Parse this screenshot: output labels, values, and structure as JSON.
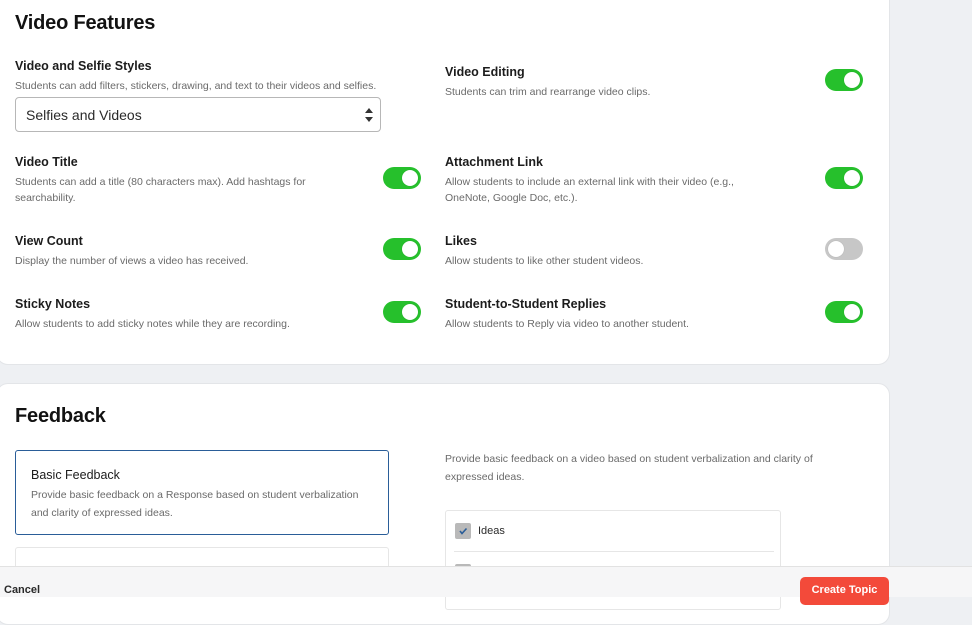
{
  "video_features": {
    "title": "Video Features",
    "styles": {
      "title": "Video and Selfie Styles",
      "description": "Students can add filters, stickers, drawing, and text to their videos and selfies.",
      "selected": "Selfies and Videos"
    },
    "items": [
      {
        "title": "Video Editing",
        "description": "Students can trim and rearrange video clips.",
        "enabled": true
      },
      {
        "title": "Video Title",
        "description": "Students can add a title (80 characters max). Add hashtags for searchability.",
        "enabled": true
      },
      {
        "title": "Attachment Link",
        "description": "Allow students to include an external link with their video (e.g., OneNote, Google Doc, etc.).",
        "enabled": true
      },
      {
        "title": "View Count",
        "description": "Display the number of views a video has received.",
        "enabled": true
      },
      {
        "title": "Likes",
        "description": "Allow students to like other student videos.",
        "enabled": false
      },
      {
        "title": "Sticky Notes",
        "description": "Allow students to add sticky notes while they are recording.",
        "enabled": true
      },
      {
        "title": "Student-to-Student Replies",
        "description": "Allow students to Reply via video to another student.",
        "enabled": true
      }
    ]
  },
  "feedback": {
    "title": "Feedback",
    "option": {
      "title": "Basic Feedback",
      "description": "Provide basic feedback on a Response based on student verbalization and clarity of expressed ideas."
    },
    "detail_description": "Provide basic feedback on a video based on student verbalization and clarity of expressed ideas.",
    "criteria": [
      {
        "label": "Ideas",
        "checked": true
      }
    ]
  },
  "footer": {
    "cancel_label": "Cancel",
    "create_label": "Create Topic"
  },
  "colors": {
    "toggle_on": "#26c02c",
    "toggle_off": "#c7c7c7",
    "primary_button": "#f34a3a",
    "selected_border": "#2a5d98"
  }
}
